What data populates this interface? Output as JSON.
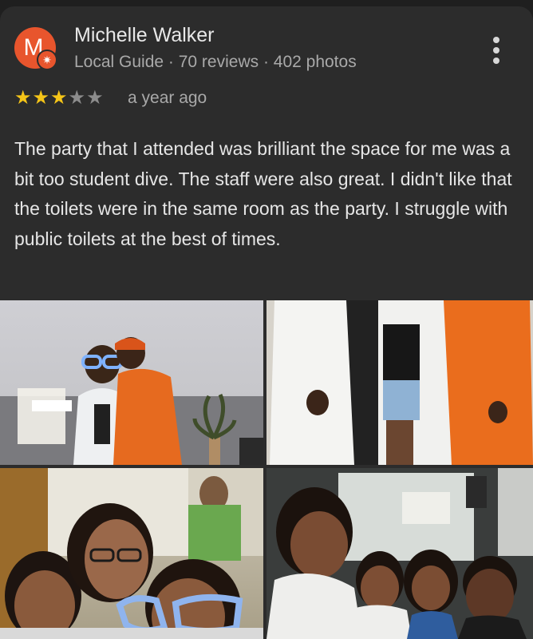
{
  "review": {
    "avatar_letter": "M",
    "author_name": "Michelle Walker",
    "author_meta": "Local Guide · 70 reviews · 402 photos",
    "rating": 3,
    "rating_max": 5,
    "time_ago": "a year ago",
    "text": "The party that I attended was brilliant the space for me was a bit too student dive. The staff were also great. I didn't like that the toilets were in the same room as the party. I struggle with public toilets at the best of times."
  },
  "colors": {
    "avatar": "#e8552d",
    "star_filled": "#f5c518",
    "star_empty": "#8c8c8c",
    "card_bg": "#2c2c2c"
  },
  "icons": {
    "local_guide_badge": "star-badge-icon",
    "more_menu": "more-vert-icon"
  },
  "photos": [
    {
      "subject": "photo-1"
    },
    {
      "subject": "photo-2"
    },
    {
      "subject": "photo-3"
    },
    {
      "subject": "photo-4"
    }
  ]
}
